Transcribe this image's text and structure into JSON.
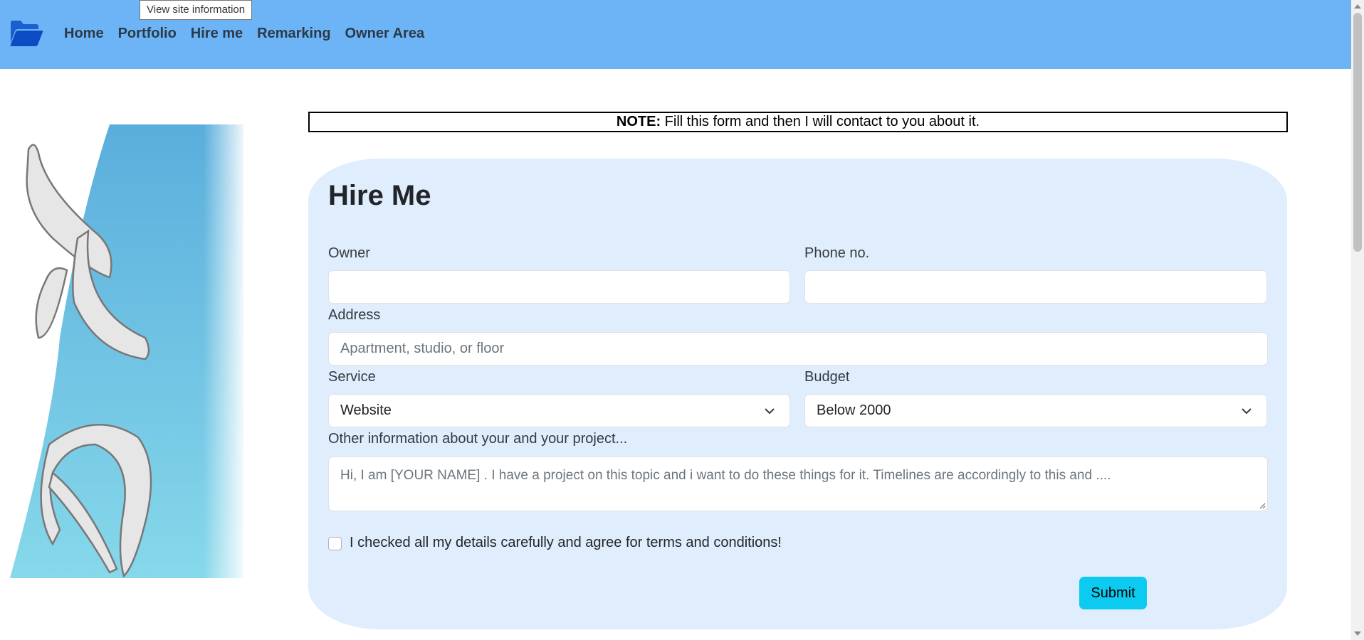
{
  "tooltip": {
    "text": "View site information"
  },
  "navbar": {
    "brand_icon": "folder-open-icon",
    "links": [
      "Home",
      "Portfolio",
      "Hire me",
      "Remarking",
      "Owner Area"
    ]
  },
  "logo": {
    "alt": "DH"
  },
  "note": {
    "prefix": "NOTE:",
    "text": " Fill this form and then I will contact to you about it."
  },
  "form": {
    "title": "Hire Me",
    "owner": {
      "label": "Owner",
      "value": ""
    },
    "phone": {
      "label": "Phone no.",
      "value": ""
    },
    "address": {
      "label": "Address",
      "placeholder": "Apartment, studio, or floor"
    },
    "service": {
      "label": "Service",
      "selected": "Website"
    },
    "budget": {
      "label": "Budget",
      "selected": "Below 2000"
    },
    "other": {
      "label": "Other information about your and your project...",
      "placeholder": "Hi, I am [YOUR NAME] . I have a project on this topic and i want to do these things for it. Timelines are accordingly to this and ...."
    },
    "agree": {
      "label": "I checked all my details carefully and agree for terms and conditions!",
      "checked": false
    },
    "submit_label": "Submit"
  },
  "colors": {
    "navbar": "#6cb4f5",
    "card": "#e0edfd",
    "submit": "#0dcaf0"
  }
}
